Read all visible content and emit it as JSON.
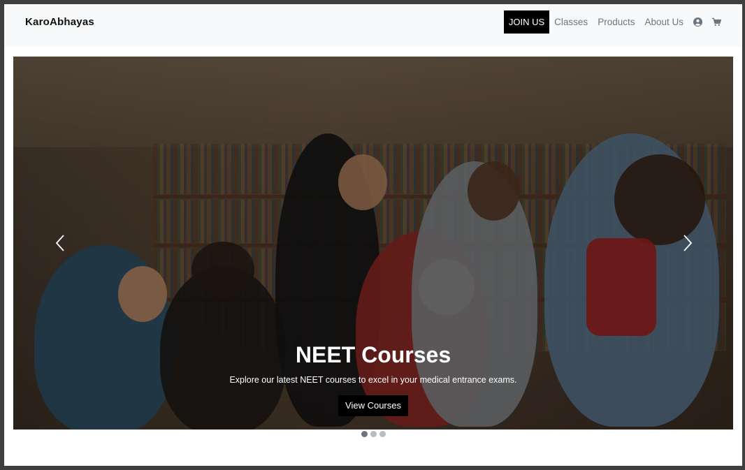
{
  "navbar": {
    "brand": "KaroAbhayas",
    "join_label": "JOIN US",
    "links": [
      "Classes",
      "Products",
      "About Us"
    ],
    "icons": [
      "user-circle-icon",
      "shopping-cart-icon"
    ]
  },
  "carousel": {
    "title": "NEET Courses",
    "text": "Explore our latest NEET courses to excel in your medical entrance exams.",
    "button_label": "View Courses",
    "prev_icon": "chevron-left-icon",
    "next_icon": "chevron-right-icon",
    "active_slide": 1,
    "slide_count": 3
  },
  "colors": {
    "navbar_bg": "#f8f9fa",
    "button_bg": "#000000",
    "link": "#6c757d"
  }
}
